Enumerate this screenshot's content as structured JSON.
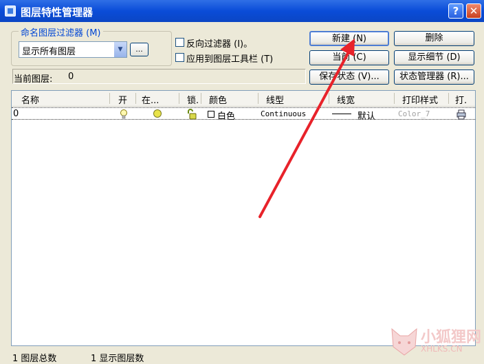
{
  "window": {
    "title": "图层特性管理器",
    "help_label": "?",
    "close_label": "✕"
  },
  "filter": {
    "legend": "命名图层过滤器 (M)",
    "selected": "显示所有图层",
    "dots_label": "...",
    "invert_label": "反向过滤器 (I)。",
    "apply_toolbar_label": "应用到图层工具栏 (T)"
  },
  "buttons": {
    "new": "新建 (N)",
    "delete": "删除",
    "current": "当前 (C)",
    "show_details": "显示细节 (D)",
    "save_state": "保存状态 (V)...",
    "state_manager": "状态管理器 (R)..."
  },
  "current_layer": {
    "label": "当前图层:",
    "value": "0"
  },
  "table": {
    "headers": [
      "名称",
      "开",
      "在...",
      "锁.",
      "颜色",
      "线型",
      "线宽",
      "打印样式",
      "打."
    ],
    "rows": [
      {
        "name": "0",
        "color": "白色",
        "linetype": "Continuous",
        "lineweight": "默认",
        "plotstyle": "Color_7"
      }
    ]
  },
  "status": {
    "total": "1  图层总数",
    "displayed": "1  显示图层数"
  },
  "watermark": {
    "text": "小狐狸网",
    "sub": "XHLKS.CN"
  },
  "icons": [
    "app-icon",
    "bulb-icon",
    "sun-icon",
    "lock-icon",
    "printer-icon",
    "chevron-down-icon",
    "fox-icon"
  ],
  "colors": {
    "title_bar": "#0a4cd8",
    "annotation_arrow": "#e8222a",
    "legend_text": "#0046d5"
  }
}
